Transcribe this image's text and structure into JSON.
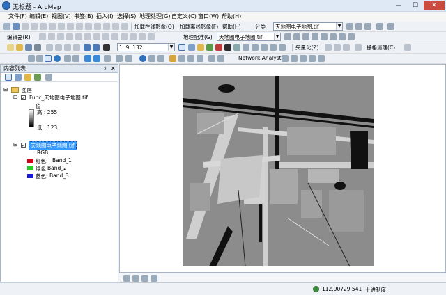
{
  "window": {
    "title": "无标题 - ArcMap",
    "minimize": "—",
    "maximize": "☐",
    "close": "✕"
  },
  "menu": [
    "文件(F)",
    "编辑(E)",
    "视图(V)",
    "书签(B)",
    "插入(I)",
    "选择(S)",
    "地理处理(G)",
    "自定义(C)",
    "窗口(W)",
    "帮助(H)"
  ],
  "toolbar1": {
    "online_imagery": "加载在线影像(O)",
    "offline_imagery": "加载离线影像(F)",
    "help": "帮助(H)",
    "classify": "分类",
    "layer_combo": "天地图电子地图.tif"
  },
  "toolbar2": {
    "editor": "编辑器(R)",
    "georef": "地理配准(G)",
    "georef_combo": "天地图电子地图.tif"
  },
  "toolbar3": {
    "scale": "1: 9, 132",
    "vectorize": "矢量化(Z)",
    "raster_cleanup": "栅格清理(C)"
  },
  "toolbar4": {
    "network_analyst": "Network Analyst"
  },
  "toc": {
    "title": "内容列表",
    "pin": "♯",
    "close": "✕",
    "root_group": "图层",
    "layer1": {
      "name": "Func_天地图电子地图.tif",
      "value_label": "值",
      "high": "高 : 255",
      "low": "低 : 123"
    },
    "layer2": {
      "name": "天地图电子地图.tif",
      "rgb_label": "RGB",
      "bands": [
        {
          "label": "红色:",
          "band": "Band_1",
          "color": "#d0021b"
        },
        {
          "label": "绿色:",
          "band": "Band_2",
          "color": "#2dc72d"
        },
        {
          "label": "蓝色:",
          "band": "Band_3",
          "color": "#1a1ad6"
        }
      ]
    }
  },
  "status": {
    "x": "112.907",
    "y": "29.541",
    "units": "十进制度"
  },
  "colors": {
    "accent": "#3399ff",
    "map_bg": "#8c8c8c",
    "selection": "#3399ff"
  }
}
